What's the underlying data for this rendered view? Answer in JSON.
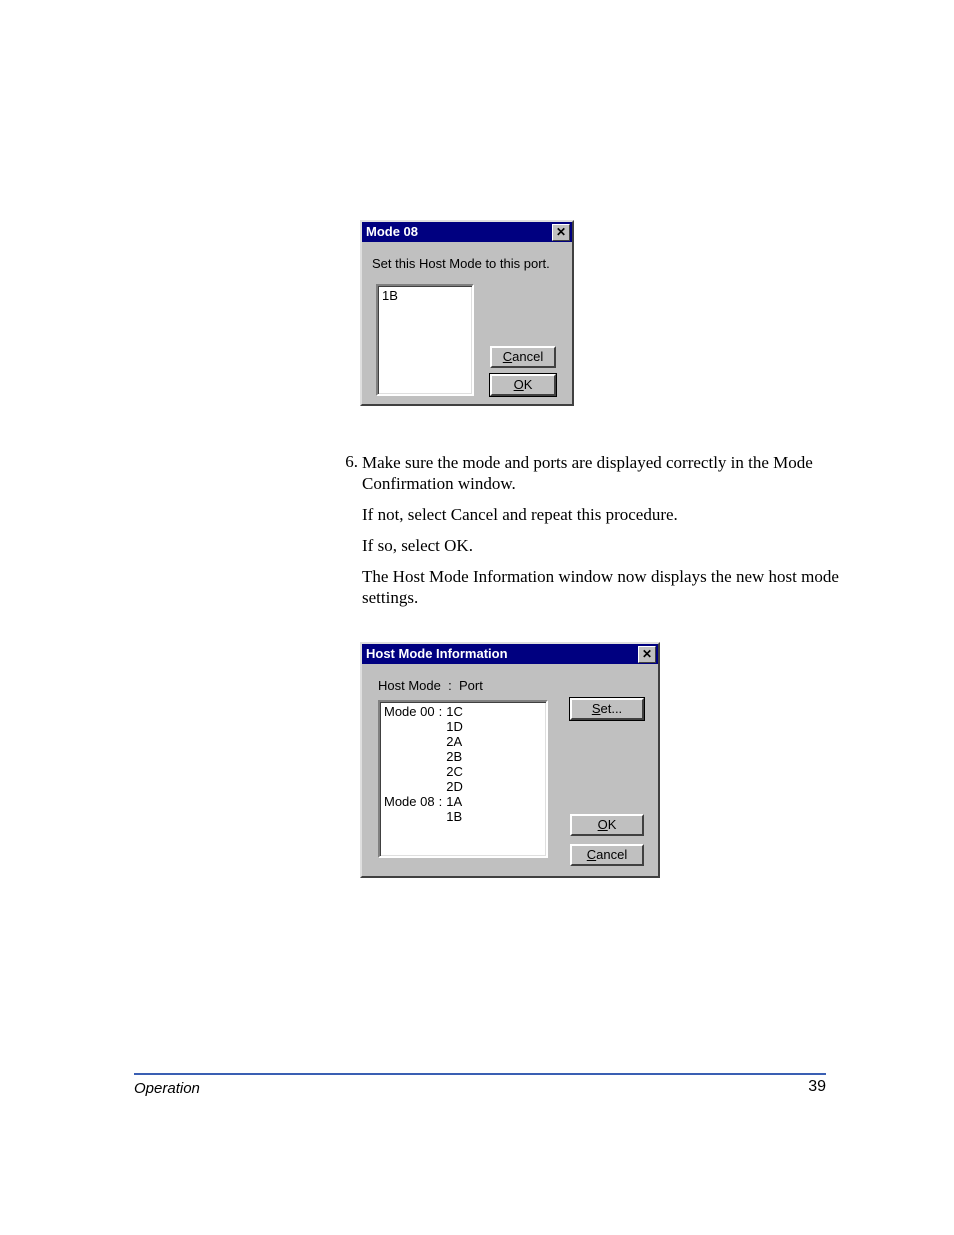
{
  "dialog1": {
    "title": "Mode 08",
    "message": "Set this Host Mode to this port.",
    "list_items": [
      "1B"
    ],
    "cancel_label_pre": "C",
    "cancel_label_post": "ancel",
    "ok_label_pre": "O",
    "ok_label_post": "K"
  },
  "step_number": "6.",
  "paragraphs": {
    "p1": "Make sure the mode and ports are displayed correctly in the Mode Confirmation window.",
    "p2": "If not, select Cancel and repeat this procedure.",
    "p3": "If so, select OK.",
    "p4": "The Host Mode Information window now displays the new host mode settings."
  },
  "dialog2": {
    "title": "Host Mode Information",
    "header_left": "Host Mode",
    "header_sep": ":",
    "header_right": "Port",
    "entries": [
      {
        "mode": "Mode 00",
        "ports": [
          "1C",
          "1D",
          "2A",
          "2B",
          "2C",
          "2D"
        ]
      },
      {
        "mode": "Mode 08",
        "ports": [
          "1A",
          "1B"
        ]
      }
    ],
    "set_label_pre": "S",
    "set_label_post": "et...",
    "ok_label_pre": "O",
    "ok_label_post": "K",
    "cancel_label_pre": "C",
    "cancel_label_post": "ancel"
  },
  "footer": {
    "left": "Operation",
    "right": "39"
  }
}
